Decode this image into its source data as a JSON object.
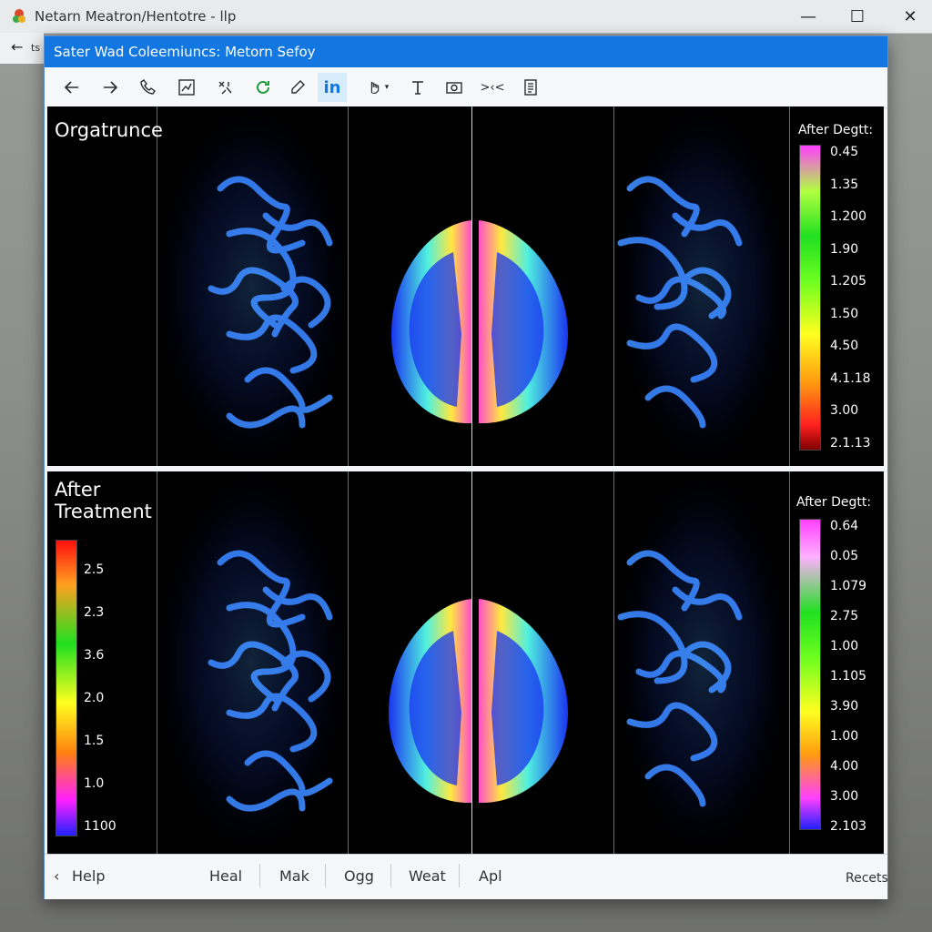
{
  "background_window": {
    "title": "Netarn Meatron/Hentotre - llp",
    "side_label": "ts",
    "controls": {
      "minimize": "—",
      "maximize": "☐",
      "close": "✕"
    }
  },
  "app_window": {
    "title": "Sater Wad Coleemiuncs: Metorn Sefoy"
  },
  "toolbar": {
    "items": [
      {
        "name": "back-icon",
        "glyph": "←"
      },
      {
        "name": "forward-icon",
        "glyph": "→"
      },
      {
        "name": "phone-icon",
        "glyph": "phone"
      },
      {
        "name": "chart-icon",
        "glyph": "chart"
      },
      {
        "name": "tools-icon",
        "glyph": "tools"
      },
      {
        "name": "refresh-icon",
        "glyph": "refresh"
      },
      {
        "name": "pen-icon",
        "glyph": "pen"
      },
      {
        "name": "linkedin-icon",
        "glyph": "in"
      },
      {
        "name": "hand-dropdown-icon",
        "glyph": "hand"
      },
      {
        "name": "text-tool-icon",
        "glyph": "text"
      },
      {
        "name": "screenshot-icon",
        "glyph": "camera"
      },
      {
        "name": "expand-icon",
        "glyph": ">‹<"
      },
      {
        "name": "document-icon",
        "glyph": "doc"
      }
    ]
  },
  "panels": {
    "top": {
      "label": "Orgatrunce",
      "colorbar": {
        "title": "After Degtt:",
        "ticks": [
          "0.45",
          "1.35",
          "1.200",
          "1.90",
          "1.205",
          "1.50",
          "4.50",
          "4.1.18",
          "3.00",
          "2.1.13"
        ]
      }
    },
    "bottom": {
      "label_line1": "After",
      "label_line2": "Treatment",
      "left_colorbar": {
        "ticks": [
          "2.5",
          "2.3",
          "3.6",
          "2.0",
          "1.5",
          "1.0",
          "1100"
        ]
      },
      "colorbar": {
        "title": "After Degtt:",
        "ticks": [
          "0.64",
          "0.05",
          "1.079",
          "2.75",
          "1.00",
          "1.105",
          "3.90",
          "1.00",
          "4.00",
          "3.00",
          "2.103"
        ]
      }
    }
  },
  "status_bar": {
    "items": [
      "Help",
      "Heal",
      "Mak",
      "Ogg",
      "Weat",
      "Apl"
    ],
    "right": "Recets"
  },
  "colors": {
    "title_bar": "#1277e0",
    "panel_bg": "#000000",
    "vessel_blue": "#3a7bff",
    "brain_blue": "#1a3cf0"
  }
}
